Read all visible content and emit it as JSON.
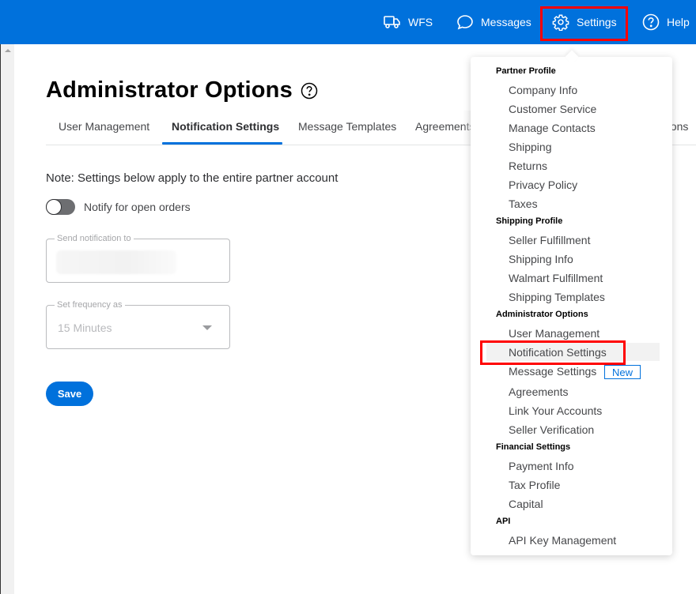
{
  "topbar": {
    "items": [
      {
        "label": "WFS",
        "icon": "truck-icon"
      },
      {
        "label": "Messages",
        "icon": "chat-bubble-icon"
      },
      {
        "label": "Settings",
        "icon": "gear-icon"
      },
      {
        "label": "Help",
        "icon": "question-circle-icon"
      }
    ]
  },
  "page": {
    "title": "Administrator Options",
    "title_icon": "question-circle-icon"
  },
  "tabs": [
    {
      "label": "User Management",
      "active": false
    },
    {
      "label": "Notification Settings",
      "active": true
    },
    {
      "label": "Message Templates",
      "active": false
    },
    {
      "label": "Agreements",
      "active": false
    },
    {
      "label": "cations",
      "active": false
    }
  ],
  "form": {
    "note": "Note: Settings below apply to the entire partner account",
    "toggle": {
      "label": "Notify for open orders",
      "on": false
    },
    "send_to": {
      "label": "Send notification to",
      "value": ""
    },
    "frequency": {
      "label": "Set frequency as",
      "value": "15 Minutes"
    },
    "save_label": "Save"
  },
  "settings_menu": {
    "sections": [
      {
        "heading": "Partner Profile",
        "items": [
          "Company Info",
          "Customer Service",
          "Manage Contacts",
          "Shipping",
          "Returns",
          "Privacy Policy",
          "Taxes"
        ]
      },
      {
        "heading": "Shipping Profile",
        "items": [
          "Seller Fulfillment",
          "Shipping Info",
          "Walmart Fulfillment",
          "Shipping Templates"
        ]
      },
      {
        "heading": "Administrator Options",
        "items": [
          "User Management",
          "Notification Settings",
          "Message Settings",
          "Agreements",
          "Link Your Accounts",
          "Seller Verification"
        ]
      },
      {
        "heading": "Financial Settings",
        "items": [
          "Payment Info",
          "Tax Profile",
          "Capital"
        ]
      },
      {
        "heading": "API",
        "items": [
          "API Key Management"
        ]
      }
    ],
    "new_badge": "New"
  },
  "colors": {
    "brand": "#0071dc",
    "highlight": "#ff0000"
  }
}
